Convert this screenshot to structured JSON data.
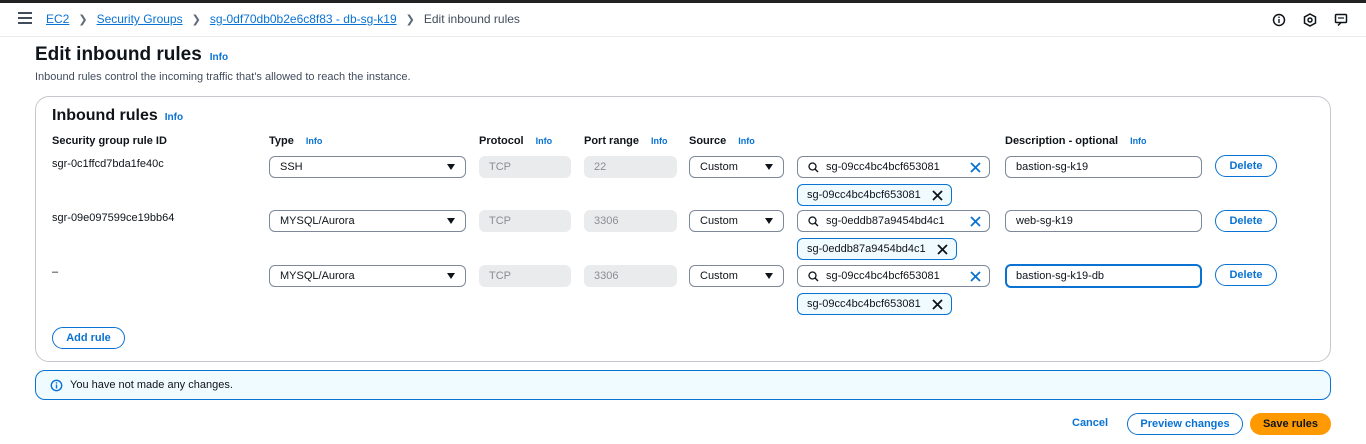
{
  "breadcrumb": {
    "items": [
      "EC2",
      "Security Groups",
      "sg-0df70db0b2e6c8f83 - db-sg-k19"
    ],
    "current": "Edit inbound rules"
  },
  "page": {
    "title": "Edit inbound rules",
    "title_info": "Info",
    "subtitle": "Inbound rules control the incoming traffic that's allowed to reach the instance."
  },
  "panel": {
    "title": "Inbound rules",
    "title_info": "Info",
    "columns": {
      "rule_id": "Security group rule ID",
      "type": "Type",
      "protocol": "Protocol",
      "port_range": "Port range",
      "source": "Source",
      "description": "Description - optional",
      "info": "Info"
    }
  },
  "rules": [
    {
      "id": "sgr-0c1ffcd7bda1fe40c",
      "type": "SSH",
      "protocol": "TCP",
      "port": "22",
      "source": "Custom",
      "search": "sg-09cc4bc4bcf653081",
      "token": "sg-09cc4bc4bcf653081",
      "description": "bastion-sg-k19",
      "delete": "Delete"
    },
    {
      "id": "sgr-09e097599ce19bb64",
      "type": "MYSQL/Aurora",
      "protocol": "TCP",
      "port": "3306",
      "source": "Custom",
      "search": "sg-0eddb87a9454bd4c1",
      "token": "sg-0eddb87a9454bd4c1",
      "description": "web-sg-k19",
      "delete": "Delete"
    },
    {
      "id": "–",
      "type": "MYSQL/Aurora",
      "protocol": "TCP",
      "port": "3306",
      "source": "Custom",
      "search": "sg-09cc4bc4bcf653081",
      "token": "sg-09cc4bc4bcf653081",
      "description": "bastion-sg-k19-db",
      "delete": "Delete"
    }
  ],
  "add_rule": "Add rule",
  "alert": {
    "text": "You have not made any changes."
  },
  "footer": {
    "cancel": "Cancel",
    "preview": "Preview changes",
    "save": "Save rules"
  },
  "colors": {
    "accent": "#0972d3",
    "primary": "#ff9900"
  },
  "icons": [
    "menu-icon",
    "info-circle-icon",
    "settings-icon",
    "feedback-icon",
    "search-icon",
    "clear-icon",
    "remove-token-icon",
    "caret-down-icon"
  ]
}
